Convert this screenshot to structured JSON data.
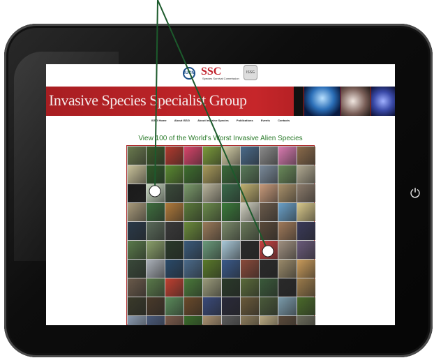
{
  "site": {
    "logos": {
      "iucn": "IUCN",
      "ssc": "SSC",
      "ssc_sub": "Species Survival Commission",
      "issg": "ISSG"
    },
    "banner_title": "Invasive Species Specialist Group",
    "nav": [
      "ISSG Home",
      "About ISSG",
      "About Invasive Species",
      "Publications",
      "Events",
      "Contacts"
    ],
    "headline": "View 100 of the World's Worst Invasive Alien Species"
  },
  "device": {
    "power_icon": "power-icon"
  },
  "grid": {
    "colors": [
      "#6a7a4e",
      "#3c5a2a",
      "#b23a2e",
      "#d8446a",
      "#7a9a3a",
      "#d6d0a8",
      "#4a6a8a",
      "#8a8a8a",
      "#d97ab0",
      "#8a6a4a",
      "#c9c29a",
      "#2e5a28",
      "#5a8a30",
      "#3e6e2e",
      "#a89a5a",
      "#3a6a3a",
      "#5a7a5a",
      "#7a8a9a",
      "#6a8a5a",
      "#b0a890",
      "#1a1a1a",
      "#c8d8c0",
      "#3a4a3a",
      "#7a9a6a",
      "#b7b29a",
      "#3a6a4a",
      "#c0b070",
      "#c89a7a",
      "#a8906a",
      "#8a7a6a",
      "#a89a7a",
      "#3e6e3e",
      "#b07a3a",
      "#5a7a3a",
      "#6a8a4a",
      "#3a7a3a",
      "#d0d0c0",
      "#6a5a4a",
      "#6aa0c8",
      "#d8c88a",
      "#2a3a4a",
      "#5a6a5a",
      "#3a3a3a",
      "#6a8a3a",
      "#9a7a5a",
      "#7a8a6a",
      "#6a7a5a",
      "#5a4a3a",
      "#a07a5a",
      "#3a3a5a",
      "#5a7a4a",
      "#8aa06a",
      "#2a3a2a",
      "#3a5a7a",
      "#6a9a7a",
      "#a8c8d8",
      "#2a2a2a",
      "#c84040",
      "#a09080",
      "#6a5a7a",
      "#3a4a3a",
      "#aab0b8",
      "#2a4a6a",
      "#4a6a8a",
      "#5a7a2a",
      "#3a5a8a",
      "#8a4a3a",
      "#2a2a2a",
      "#9a8a6a",
      "#c89a5a",
      "#6a5a4a",
      "#5a7a4a",
      "#c04030",
      "#4a7a3a",
      "#9a9a7a",
      "#2a3a2a",
      "#5a6a3a",
      "#3a5a3a",
      "#2a2a2a",
      "#9a7a4a",
      "#3a3a2a",
      "#4a3a2a",
      "#5a8a5a",
      "#6a4a2a",
      "#3a4a7a",
      "#2a2a3a",
      "#6a5a3a",
      "#4a5a3a",
      "#7a9aaa",
      "#4a6a2a",
      "#8a9ab0",
      "#4a5a7a",
      "#7a5a4a",
      "#3a6a2a",
      "#a89070",
      "#5a5a5a",
      "#8a7a5a",
      "#b8a880",
      "#5a4a3a",
      "#6a6a5a"
    ]
  }
}
